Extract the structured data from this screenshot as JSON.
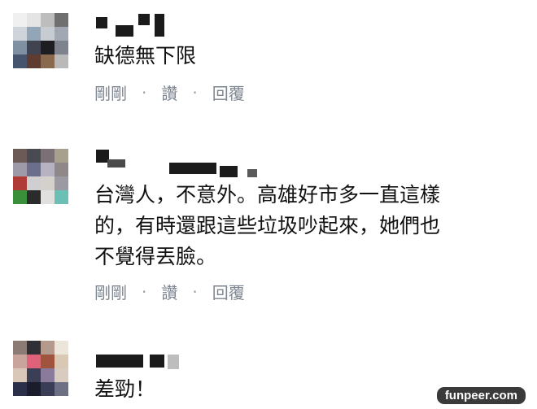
{
  "comments": [
    {
      "text": "缺德無下限",
      "actions": {
        "time": "剛剛",
        "like": "讚",
        "reply": "回覆",
        "separator": "·"
      },
      "avatar_colors": [
        "#f0f0f0",
        "#e4e4e4",
        "#bdbdbd",
        "#6f6f6f",
        "#cfd4da",
        "#92a6b8",
        "#c6ccd1",
        "#a1a8b2",
        "#8090a3",
        "#3f4450",
        "#1d1d22",
        "#7d828c",
        "#46556d",
        "#5e3c32",
        "#8a6a4e",
        "#b9b9b9"
      ]
    },
    {
      "text": "台灣人，不意外。高雄好市多一直這樣\n的，有時還跟這些垃圾吵起來，她們也\n不覺得丟臉。",
      "actions": {
        "time": "剛剛",
        "like": "讚",
        "reply": "回覆",
        "separator": "·"
      },
      "avatar_colors": [
        "#6b5a55",
        "#4a4a52",
        "#7b7076",
        "#a7a08c",
        "#9e9aa8",
        "#6c6f8c",
        "#b7b2c1",
        "#8f8888",
        "#b03b36",
        "#cfcfd2",
        "#d4d0cc",
        "#9b9aa2",
        "#3a8f3a",
        "#2b2b2b",
        "#e2e0de",
        "#6bbfb4"
      ]
    },
    {
      "text": "差勁！",
      "actions": {
        "time": "",
        "like": "",
        "reply": "",
        "separator": ""
      },
      "avatar_colors": [
        "#8c7b75",
        "#2f2f35",
        "#b39a8c",
        "#ece6da",
        "#c8a49c",
        "#e0627a",
        "#a0543e",
        "#d9c9b4",
        "#d9c7b8",
        "#3b3f55",
        "#8a7a9b",
        "#d8cbc0",
        "#2c2f4a",
        "#1b1c2c",
        "#3a3d56",
        "#6d6f85"
      ]
    }
  ],
  "watermark": "funpeer.com"
}
